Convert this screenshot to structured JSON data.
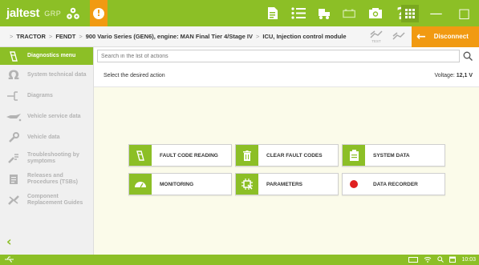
{
  "topbar": {
    "logo_text": "jaltest",
    "logo_sub": "GRP",
    "alert_symbol": "!",
    "colors": {
      "primary": "#8cbf26",
      "accent": "#f19a12"
    },
    "icons": [
      "document-icon",
      "list-icon",
      "truck-icon",
      "battery-icon",
      "camera-icon",
      "help-icon",
      "apps-icon"
    ]
  },
  "window": {
    "minimize": "—",
    "maximize": "□",
    "close": "✕"
  },
  "breadcrumb": {
    "items": [
      "TRACTOR",
      "FENDT",
      "900 Vario Series (GEN6), engine: MAN Final Tier 4/Stage IV",
      "ICU, Injection control module"
    ],
    "separator": ">",
    "test_label": "TEST",
    "disconnect_label": "Disconnect"
  },
  "sidebar": {
    "items": [
      {
        "label": "Diagnostics menu",
        "icon": "diagnostics-icon",
        "active": true
      },
      {
        "label": "System technical data",
        "icon": "ohm-icon"
      },
      {
        "label": "Diagrams",
        "icon": "diagram-icon"
      },
      {
        "label": "Vehicle service data",
        "icon": "oil-can-icon"
      },
      {
        "label": "Vehicle data",
        "icon": "wrench-icon"
      },
      {
        "label": "Troubleshooting by symptoms",
        "icon": "troubleshooting-icon"
      },
      {
        "label": "Releases and Procedures (TSBs)",
        "icon": "procedures-icon"
      },
      {
        "label": "Component Replacement Guides",
        "icon": "replacement-icon"
      }
    ],
    "back_symbol": "‹"
  },
  "main": {
    "search_placeholder": "Search in the list of actions",
    "instruction": "Select the desired action",
    "voltage_label": "Voltage:",
    "voltage_value": "12,1 V",
    "actions": [
      {
        "label": "FAULT CODE READING",
        "icon": "fault-code-icon",
        "style": "green"
      },
      {
        "label": "CLEAR FAULT CODES",
        "icon": "trash-icon",
        "style": "green"
      },
      {
        "label": "SYSTEM DATA",
        "icon": "clipboard-icon",
        "style": "green"
      },
      {
        "label": "MONITORING",
        "icon": "gauge-icon",
        "style": "green"
      },
      {
        "label": "PARAMETERS",
        "icon": "chip-icon",
        "style": "green"
      },
      {
        "label": "DATA RECORDER",
        "icon": "record-icon",
        "style": "record",
        "color": "#e02020"
      }
    ]
  },
  "statusbar": {
    "time": "10:03"
  }
}
